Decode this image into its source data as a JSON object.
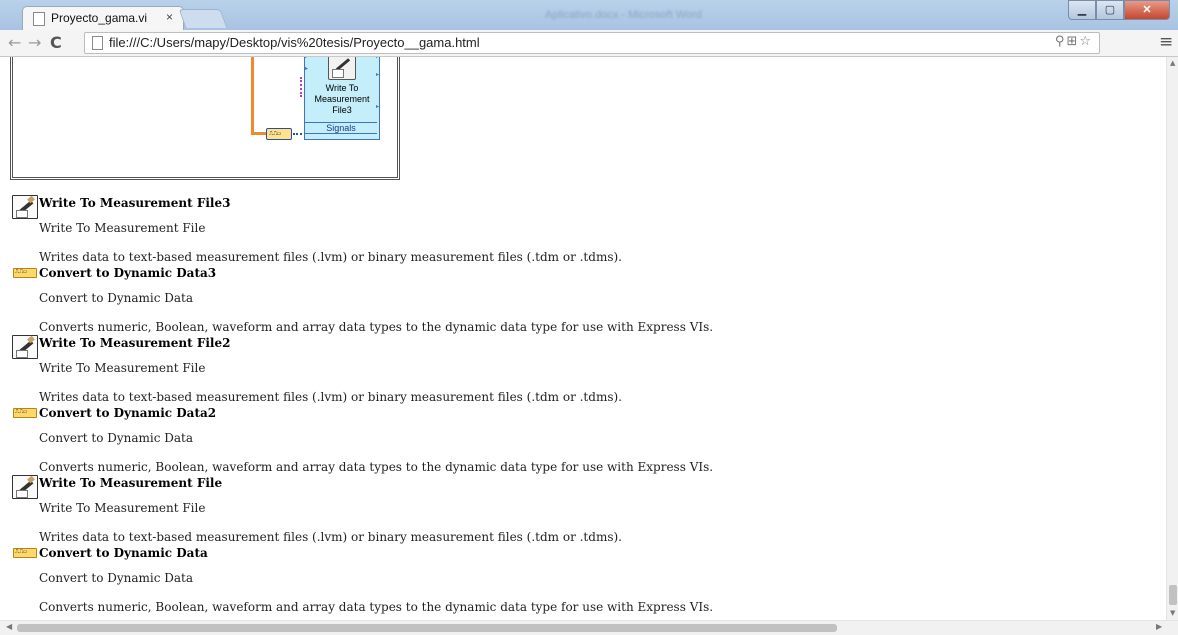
{
  "browser": {
    "tab_title": "Proyecto_gama.vi",
    "tab_close": "×",
    "background_window_title": "Aplicativo.docx - Microsoft Word",
    "url": "file:///C:/Users/mapy/Desktop/vis%20tesis/Proyecto__gama.html",
    "window_buttons": {
      "minimize": "▁",
      "maximize": "▢",
      "close": "✕"
    }
  },
  "diagram": {
    "node_caption_line1": "Write To",
    "node_caption_line2": "Measurement",
    "node_caption_line3": "File3",
    "node_signals_label": "Signals",
    "dynamic_glyph": "⎍⎍▭"
  },
  "entries": [
    {
      "icon": "write-measurement-icon",
      "title": "Write To Measurement File3",
      "subtitle": "Write To Measurement File",
      "description": "Writes data to text-based measurement files (.lvm) or binary measurement files (.tdm or .tdms)."
    },
    {
      "icon": "convert-dynamic-icon",
      "title": "Convert to Dynamic Data3",
      "subtitle": "Convert to Dynamic Data",
      "description": "Converts numeric, Boolean, waveform and array data types to the dynamic data type for use with Express VIs."
    },
    {
      "icon": "write-measurement-icon",
      "title": "Write To Measurement File2",
      "subtitle": "Write To Measurement File",
      "description": "Writes data to text-based measurement files (.lvm) or binary measurement files (.tdm or .tdms)."
    },
    {
      "icon": "convert-dynamic-icon",
      "title": "Convert to Dynamic Data2",
      "subtitle": "Convert to Dynamic Data",
      "description": "Converts numeric, Boolean, waveform and array data types to the dynamic data type for use with Express VIs."
    },
    {
      "icon": "write-measurement-icon",
      "title": "Write To Measurement File",
      "subtitle": "Write To Measurement File",
      "description": "Writes data to text-based measurement files (.lvm) or binary measurement files (.tdm or .tdms)."
    },
    {
      "icon": "convert-dynamic-icon",
      "title": "Convert to Dynamic Data",
      "subtitle": "Convert to Dynamic Data",
      "description": "Converts numeric, Boolean, waveform and array data types to the dynamic data type for use with Express VIs."
    }
  ]
}
